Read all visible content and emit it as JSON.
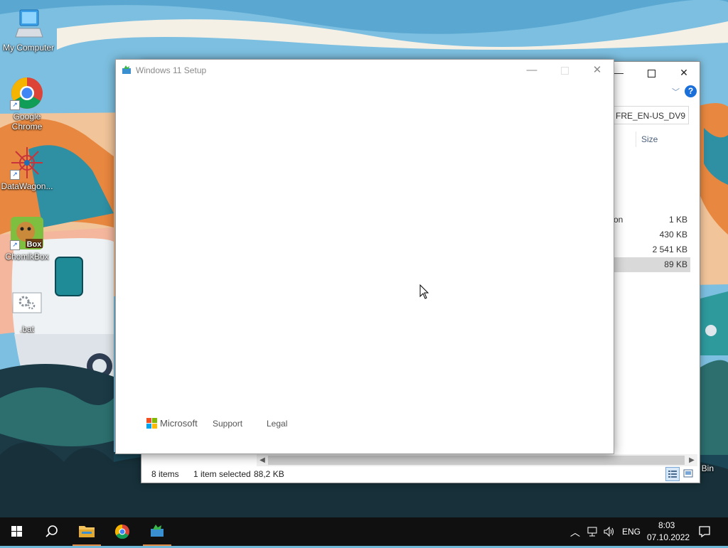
{
  "desktop": {
    "icons": [
      {
        "label": "My Computer"
      },
      {
        "label": "Google\nChrome"
      },
      {
        "label": "DataWagon..."
      },
      {
        "label": "ChomikBox"
      },
      {
        "label": ".bat"
      }
    ],
    "partial_recycle_label": "Bin"
  },
  "explorer": {
    "path_fragment": "FRE_EN-US_DV9",
    "column_size_header": "Size",
    "rows": [
      {
        "name": "on",
        "size": "1 KB",
        "selected": false
      },
      {
        "name": "",
        "size": "430 KB",
        "selected": false
      },
      {
        "name": "",
        "size": "2 541 KB",
        "selected": false
      },
      {
        "name": "",
        "size": "89 KB",
        "selected": true
      }
    ],
    "status": {
      "items": "8 items",
      "selected": "1 item selected",
      "size": "88,2 KB"
    }
  },
  "setup": {
    "title": "Windows 11 Setup",
    "footer": {
      "brand": "Microsoft",
      "support": "Support",
      "legal": "Legal"
    }
  },
  "taskbar": {
    "language": "ENG",
    "time": "8:03",
    "date": "07.10.2022"
  },
  "colors": {
    "taskbar_bg": "#101010",
    "running_indicator": "#e08a46",
    "ms_red": "#f25022",
    "ms_green": "#7fba00",
    "ms_blue": "#00a4ef",
    "ms_yellow": "#ffb900"
  }
}
